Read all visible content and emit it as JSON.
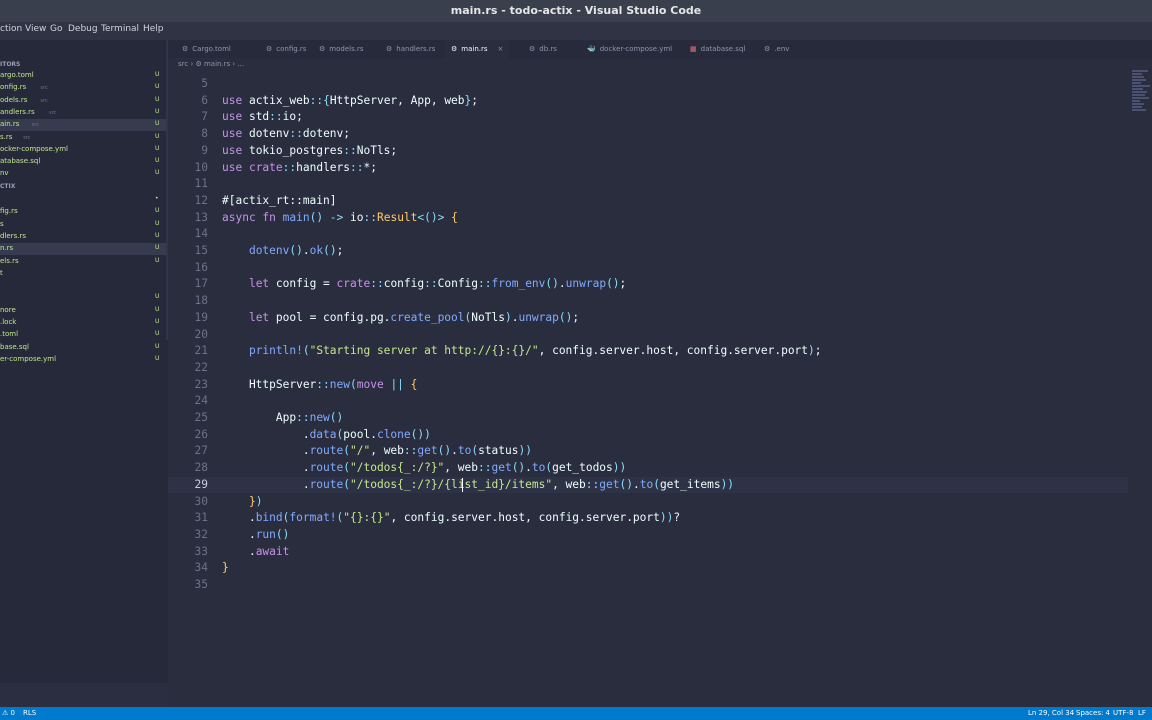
{
  "window": {
    "title": "main.rs - todo-actix - Visual Studio Code"
  },
  "menu": [
    "ction",
    "View",
    "Go",
    "Debug",
    "Terminal",
    "Help"
  ],
  "sidebar": {
    "section1": "ITORS",
    "open_editors": [
      {
        "name": "argo.toml",
        "hint": "",
        "status": "U"
      },
      {
        "name": "onfig.rs",
        "hint": "src",
        "status": "U"
      },
      {
        "name": "odels.rs",
        "hint": "src",
        "status": "U"
      },
      {
        "name": "andlers.rs",
        "hint": "src",
        "status": "U"
      },
      {
        "name": "ain.rs",
        "hint": "src",
        "status": "U"
      },
      {
        "name": "s.rs",
        "hint": "src",
        "status": "U"
      },
      {
        "name": "ocker-compose.yml",
        "hint": "",
        "status": "U"
      },
      {
        "name": "atabase.sql",
        "hint": "",
        "status": "U"
      },
      {
        "name": "nv",
        "hint": "",
        "status": "U"
      }
    ],
    "section2": "CTIX",
    "files": [
      {
        "name": "",
        "hint": "",
        "status": "•"
      },
      {
        "name": "fig.rs",
        "hint": "",
        "status": "U"
      },
      {
        "name": "s",
        "hint": "",
        "status": "U"
      },
      {
        "name": "dlers.rs",
        "hint": "",
        "status": "U"
      },
      {
        "name": "n.rs",
        "hint": "",
        "status": "U"
      },
      {
        "name": "els.rs",
        "hint": "",
        "status": "U"
      },
      {
        "name": "t",
        "hint": "",
        "status": ""
      },
      {
        "name": "",
        "hint": "",
        "status": ""
      },
      {
        "name": "",
        "hint": "",
        "status": "U"
      },
      {
        "name": "nore",
        "hint": "",
        "status": "U"
      },
      {
        "name": ".lock",
        "hint": "",
        "status": "U"
      },
      {
        "name": ".toml",
        "hint": "",
        "status": "U"
      },
      {
        "name": "base.sql",
        "hint": "",
        "status": "U"
      },
      {
        "name": "er-compose.yml",
        "hint": "",
        "status": "U"
      }
    ]
  },
  "tabs": [
    {
      "label": "Cargo.toml",
      "icon": "⚙",
      "color": "#8f96ad"
    },
    {
      "label": "config.rs",
      "icon": "⚙",
      "color": "#8f96ad"
    },
    {
      "label": "models.rs",
      "icon": "⚙",
      "color": "#8f96ad"
    },
    {
      "label": "handlers.rs",
      "icon": "⚙",
      "color": "#8f96ad"
    },
    {
      "label": "main.rs",
      "icon": "⚙",
      "color": "#eeffff"
    },
    {
      "label": "db.rs",
      "icon": "⚙",
      "color": "#8f96ad"
    },
    {
      "label": "docker-compose.yml",
      "icon": "🐳",
      "color": "#f07178"
    },
    {
      "label": "database.sql",
      "icon": "▦",
      "color": "#f07178"
    },
    {
      "label": ".env",
      "icon": "⚙",
      "color": "#8f96ad"
    }
  ],
  "tab_close": "×",
  "breadcrumb": "src  ›  ⚙ main.rs  ›  ...",
  "current_line": 29,
  "code": [
    {
      "n": 5,
      "t": []
    },
    {
      "n": 6,
      "t": [
        [
          "kw",
          "use "
        ],
        [
          "id",
          "actix_web"
        ],
        [
          "op",
          "::"
        ],
        [
          "pu",
          "{"
        ],
        [
          "id",
          "HttpServer, App, web"
        ],
        [
          "pu",
          "}"
        ],
        [
          "id",
          ";"
        ]
      ]
    },
    {
      "n": 7,
      "t": [
        [
          "kw",
          "use "
        ],
        [
          "id",
          "std"
        ],
        [
          "op",
          "::"
        ],
        [
          "id",
          "io;"
        ]
      ]
    },
    {
      "n": 8,
      "t": [
        [
          "kw",
          "use "
        ],
        [
          "id",
          "dotenv"
        ],
        [
          "op",
          "::"
        ],
        [
          "id",
          "dotenv;"
        ]
      ]
    },
    {
      "n": 9,
      "t": [
        [
          "kw",
          "use "
        ],
        [
          "id",
          "tokio_postgres"
        ],
        [
          "op",
          "::"
        ],
        [
          "id",
          "NoTls;"
        ]
      ]
    },
    {
      "n": 10,
      "t": [
        [
          "kw",
          "use "
        ],
        [
          "kw",
          "crate"
        ],
        [
          "op",
          "::"
        ],
        [
          "id",
          "handlers"
        ],
        [
          "op",
          "::"
        ],
        [
          "id",
          "*;"
        ]
      ]
    },
    {
      "n": 11,
      "t": []
    },
    {
      "n": 12,
      "t": [
        [
          "id",
          "#[actix_rt::main]"
        ]
      ]
    },
    {
      "n": 13,
      "t": [
        [
          "kw",
          "async fn "
        ],
        [
          "fn",
          "main"
        ],
        [
          "pu",
          "() "
        ],
        [
          "op",
          "-> "
        ],
        [
          "id",
          "io"
        ],
        [
          "op",
          "::"
        ],
        [
          "ty",
          "Result"
        ],
        [
          "pu",
          "<()>"
        ],
        [
          "id",
          " "
        ],
        [
          "ty",
          "{"
        ]
      ]
    },
    {
      "n": 14,
      "t": []
    },
    {
      "n": 15,
      "t": [
        [
          "id",
          "    "
        ],
        [
          "fn",
          "dotenv"
        ],
        [
          "pu",
          "()"
        ],
        [
          "id",
          "."
        ],
        [
          "fn",
          "ok"
        ],
        [
          "pu",
          "()"
        ],
        [
          "id",
          ";"
        ]
      ]
    },
    {
      "n": 16,
      "t": []
    },
    {
      "n": 17,
      "t": [
        [
          "id",
          "    "
        ],
        [
          "kw",
          "let "
        ],
        [
          "id",
          "config = "
        ],
        [
          "kw",
          "crate"
        ],
        [
          "op",
          "::"
        ],
        [
          "id",
          "config"
        ],
        [
          "op",
          "::"
        ],
        [
          "id",
          "Config"
        ],
        [
          "op",
          "::"
        ],
        [
          "fn",
          "from_env"
        ],
        [
          "pu",
          "()"
        ],
        [
          "id",
          "."
        ],
        [
          "fn",
          "unwrap"
        ],
        [
          "pu",
          "()"
        ],
        [
          "id",
          ";"
        ]
      ]
    },
    {
      "n": 18,
      "t": []
    },
    {
      "n": 19,
      "t": [
        [
          "id",
          "    "
        ],
        [
          "kw",
          "let "
        ],
        [
          "id",
          "pool = config.pg."
        ],
        [
          "fn",
          "create_pool"
        ],
        [
          "pu",
          "("
        ],
        [
          "id",
          "NoTls"
        ],
        [
          "pu",
          ")"
        ],
        [
          "id",
          "."
        ],
        [
          "fn",
          "unwrap"
        ],
        [
          "pu",
          "()"
        ],
        [
          "id",
          ";"
        ]
      ]
    },
    {
      "n": 20,
      "t": []
    },
    {
      "n": 21,
      "t": [
        [
          "id",
          "    "
        ],
        [
          "mc",
          "println!"
        ],
        [
          "pu",
          "("
        ],
        [
          "st",
          "\"Starting server at http://{}:{}/\""
        ],
        [
          "id",
          ", config.server.host, config.server.port"
        ],
        [
          "pu",
          ")"
        ],
        [
          "id",
          ";"
        ]
      ]
    },
    {
      "n": 22,
      "t": []
    },
    {
      "n": 23,
      "t": [
        [
          "id",
          "    HttpServer"
        ],
        [
          "op",
          "::"
        ],
        [
          "fn",
          "new"
        ],
        [
          "pu",
          "("
        ],
        [
          "kw",
          "move "
        ],
        [
          "op",
          "|| "
        ],
        [
          "ty",
          "{"
        ]
      ]
    },
    {
      "n": 24,
      "t": []
    },
    {
      "n": 25,
      "t": [
        [
          "id",
          "        App"
        ],
        [
          "op",
          "::"
        ],
        [
          "fn",
          "new"
        ],
        [
          "pu",
          "()"
        ]
      ]
    },
    {
      "n": 26,
      "t": [
        [
          "id",
          "            ."
        ],
        [
          "fn",
          "data"
        ],
        [
          "pu",
          "("
        ],
        [
          "id",
          "pool."
        ],
        [
          "fn",
          "clone"
        ],
        [
          "pu",
          "()"
        ],
        [
          "pu",
          ")"
        ]
      ]
    },
    {
      "n": 27,
      "t": [
        [
          "id",
          "            ."
        ],
        [
          "fn",
          "route"
        ],
        [
          "pu",
          "("
        ],
        [
          "st",
          "\"/\""
        ],
        [
          "id",
          ", web"
        ],
        [
          "op",
          "::"
        ],
        [
          "fn",
          "get"
        ],
        [
          "pu",
          "()"
        ],
        [
          "id",
          "."
        ],
        [
          "fn",
          "to"
        ],
        [
          "pu",
          "("
        ],
        [
          "id",
          "status"
        ],
        [
          "pu",
          "))"
        ]
      ]
    },
    {
      "n": 28,
      "t": [
        [
          "id",
          "            ."
        ],
        [
          "fn",
          "route"
        ],
        [
          "pu",
          "("
        ],
        [
          "st",
          "\"/todos{_:/?}\""
        ],
        [
          "id",
          ", web"
        ],
        [
          "op",
          "::"
        ],
        [
          "fn",
          "get"
        ],
        [
          "pu",
          "()"
        ],
        [
          "id",
          "."
        ],
        [
          "fn",
          "to"
        ],
        [
          "pu",
          "("
        ],
        [
          "id",
          "get_todos"
        ],
        [
          "pu",
          "))"
        ]
      ]
    },
    {
      "n": 29,
      "t": [
        [
          "id",
          "            ."
        ],
        [
          "fn",
          "route"
        ],
        [
          "pu",
          "("
        ],
        [
          "st",
          "\"/todos{_:/?}/{list_id}/items\""
        ],
        [
          "id",
          ", web"
        ],
        [
          "op",
          "::"
        ],
        [
          "fn",
          "get"
        ],
        [
          "pu",
          "()"
        ],
        [
          "id",
          "."
        ],
        [
          "fn",
          "to"
        ],
        [
          "pu",
          "("
        ],
        [
          "id",
          "get_items"
        ],
        [
          "pu",
          "))"
        ]
      ]
    },
    {
      "n": 30,
      "t": [
        [
          "id",
          "    "
        ],
        [
          "ty",
          "}"
        ],
        [
          "pu",
          ")"
        ]
      ]
    },
    {
      "n": 31,
      "t": [
        [
          "id",
          "    ."
        ],
        [
          "fn",
          "bind"
        ],
        [
          "pu",
          "("
        ],
        [
          "mc",
          "format!"
        ],
        [
          "pu",
          "("
        ],
        [
          "st",
          "\"{}:{}\""
        ],
        [
          "id",
          ", config.server.host, config.server.port"
        ],
        [
          "pu",
          "))"
        ],
        [
          "id",
          "?"
        ]
      ]
    },
    {
      "n": 32,
      "t": [
        [
          "id",
          "    ."
        ],
        [
          "fn",
          "run"
        ],
        [
          "pu",
          "()"
        ]
      ]
    },
    {
      "n": 33,
      "t": [
        [
          "id",
          "    ."
        ],
        [
          "kw",
          "await"
        ]
      ]
    },
    {
      "n": 34,
      "t": [
        [
          "ty",
          "}"
        ]
      ]
    },
    {
      "n": 35,
      "t": []
    }
  ],
  "status": {
    "left": "⚠ 0",
    "rls": "RLS",
    "position": "Ln 29, Col 34",
    "spaces": "Spaces: 4",
    "encoding": "UTF-8",
    "eol": "LF"
  },
  "colors": {
    "editor_bg": "#292d3e",
    "statusbar": "#007acc",
    "keyword": "#c792ea",
    "string": "#c3e88d",
    "function": "#82aaff",
    "type": "#ffcb6b"
  }
}
